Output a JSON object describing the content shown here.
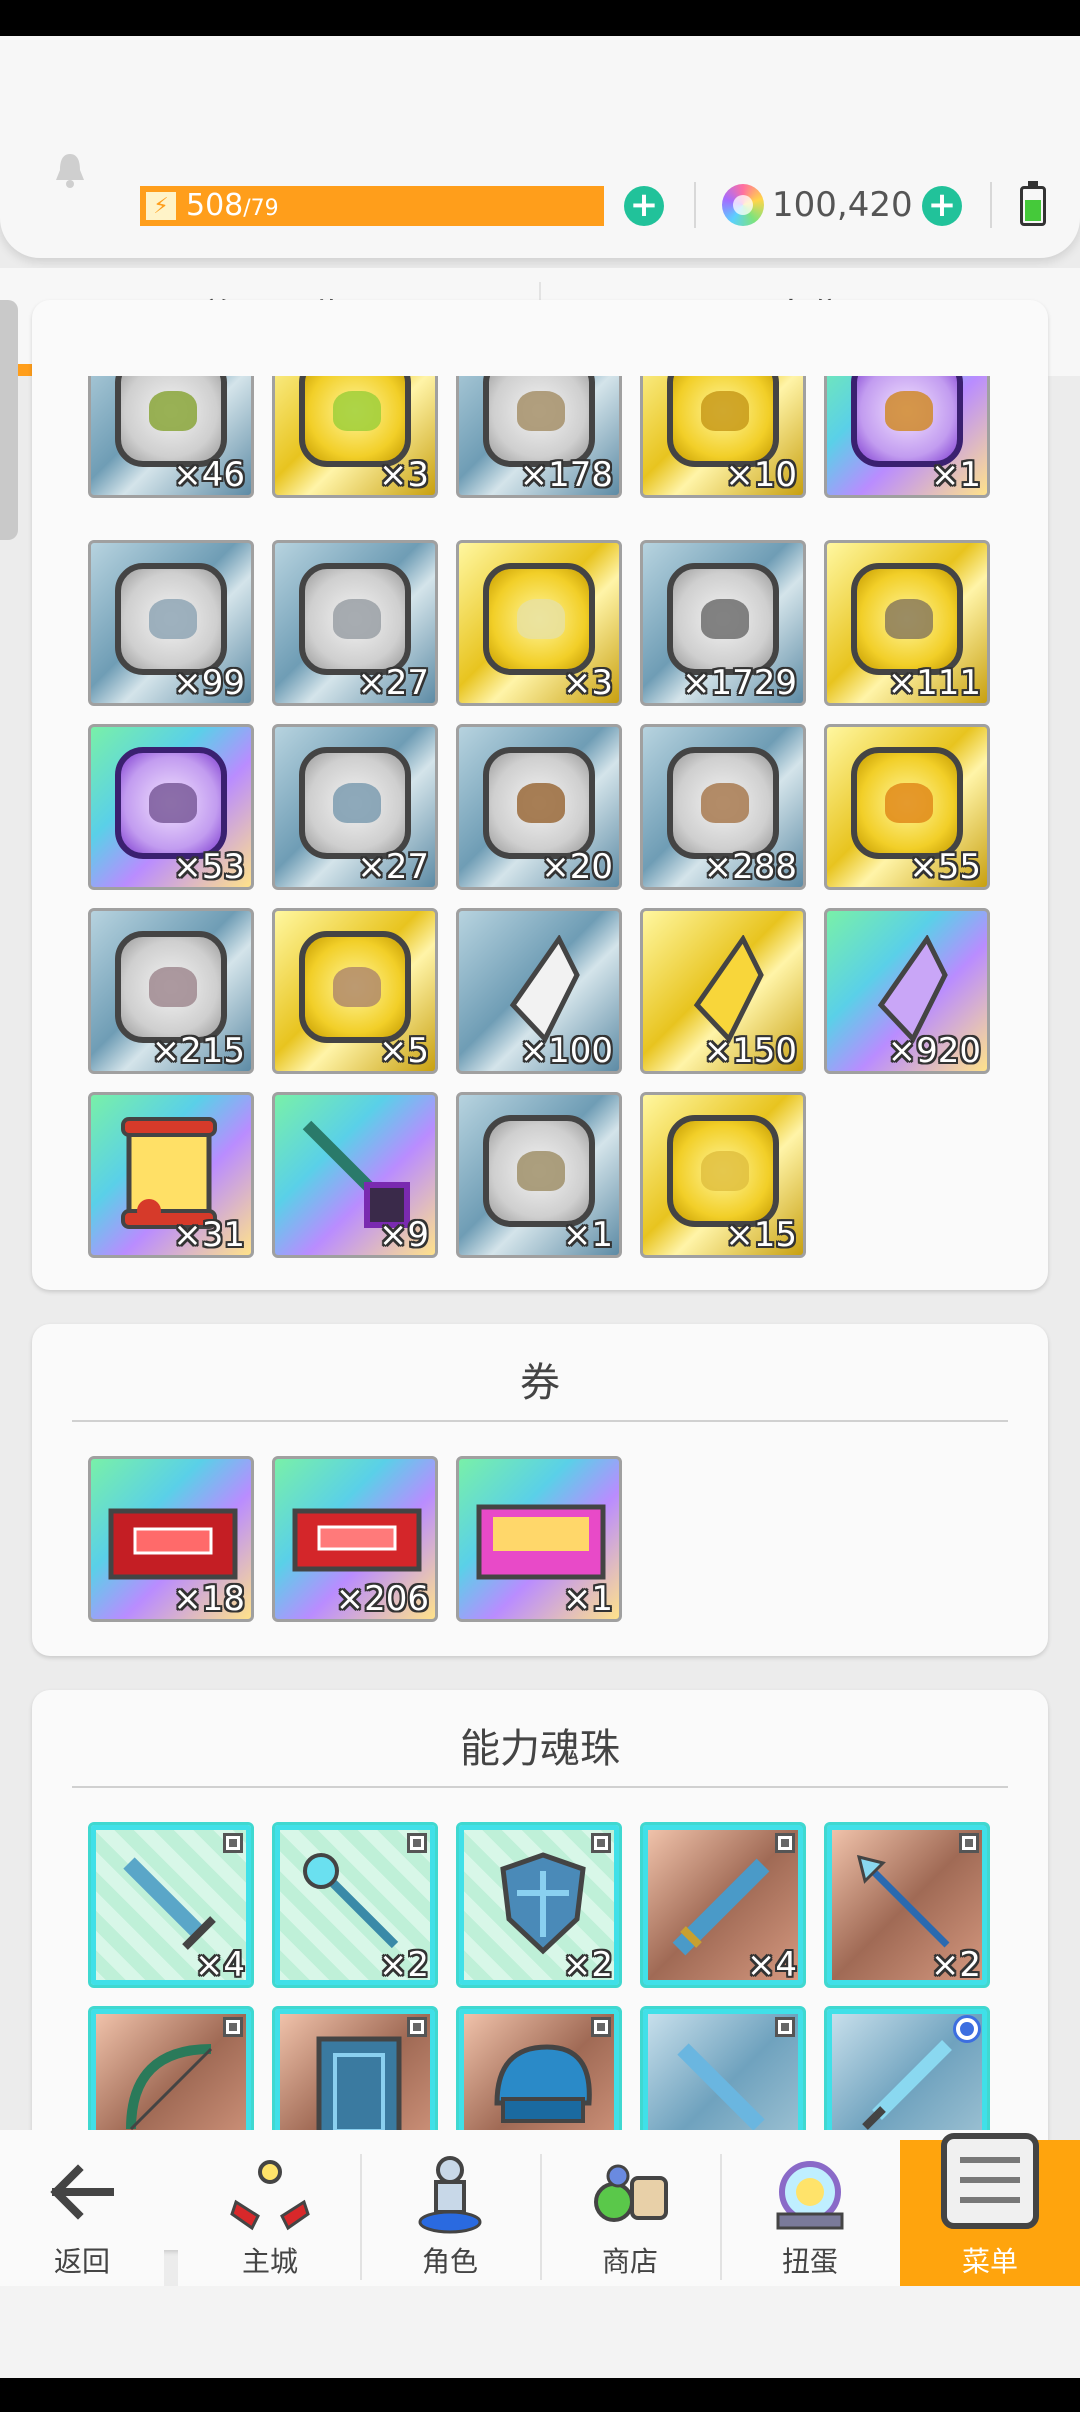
{
  "header": {
    "stamina_current": "508",
    "stamina_max": "/79",
    "gems": "100,420"
  },
  "tabs": [
    {
      "label": "道具一览",
      "active": true
    },
    {
      "label": "出售",
      "active": false
    }
  ],
  "sections": {
    "coins": {
      "rows": [
        [
          {
            "icon": "green-slime-coin-icon",
            "count": "×46"
          },
          {
            "icon": "gold-slime-coin-icon",
            "count": "×3"
          },
          {
            "icon": "silver-beast-coin-icon",
            "count": "×178"
          },
          {
            "icon": "gold-beast-coin-icon",
            "count": "×10"
          },
          {
            "icon": "purple-beast-coin-icon",
            "count": "×1"
          }
        ],
        [
          {
            "icon": "silver-bird-coin-icon",
            "count": "×99"
          },
          {
            "icon": "silver-bat-coin-icon",
            "count": "×27"
          },
          {
            "icon": "gold-bat-coin-icon",
            "count": "×3"
          },
          {
            "icon": "silver-dragon-coin-icon",
            "count": "×1729"
          },
          {
            "icon": "gold-dragon-coin-icon",
            "count": "×111"
          }
        ],
        [
          {
            "icon": "purple-dragon-coin-icon",
            "count": "×53"
          },
          {
            "icon": "silver-knight-coin-icon",
            "count": "×27"
          },
          {
            "icon": "bronze-golem-coin-icon",
            "count": "×20"
          },
          {
            "icon": "bronze-lion-coin-icon",
            "count": "×288"
          },
          {
            "icon": "gold-lion-coin-icon",
            "count": "×55"
          }
        ],
        [
          {
            "icon": "silver-demon-coin-icon",
            "count": "×215"
          },
          {
            "icon": "gold-demon-coin-icon",
            "count": "×5"
          },
          {
            "icon": "white-crystal-icon",
            "count": "×100"
          },
          {
            "icon": "gold-crystal-icon",
            "count": "×150"
          },
          {
            "icon": "purple-crystal-icon",
            "count": "×920"
          }
        ],
        [
          {
            "icon": "scroll-icon",
            "count": "×31"
          },
          {
            "icon": "key-icon",
            "count": "×9"
          },
          {
            "icon": "silver-rune-coin-icon",
            "count": "×1"
          },
          {
            "icon": "gold-rune-coin-icon",
            "count": "×15"
          }
        ]
      ]
    },
    "tickets": {
      "title": "券",
      "items": [
        {
          "icon": "red-ticket-icon",
          "count": "×18"
        },
        {
          "icon": "red-ticket-icon",
          "count": "×206"
        },
        {
          "icon": "rainbow-ticket-icon",
          "count": "×1"
        }
      ]
    },
    "orbs": {
      "title": "能力魂珠",
      "rows": [
        [
          {
            "icon": "sword-icon",
            "count": "×4"
          },
          {
            "icon": "staff-icon",
            "count": "×2"
          },
          {
            "icon": "shield-icon",
            "count": "×2"
          },
          {
            "icon": "greatsword-icon",
            "count": "×4"
          },
          {
            "icon": "spear-icon",
            "count": "×2"
          }
        ],
        [
          {
            "icon": "bow-icon",
            "count": ""
          },
          {
            "icon": "book-icon",
            "count": ""
          },
          {
            "icon": "helmet-icon",
            "count": ""
          },
          {
            "icon": "blade-icon",
            "count": ""
          },
          {
            "icon": "dagger-icon",
            "count": ""
          }
        ]
      ]
    }
  },
  "nav": {
    "back": "返回",
    "items": [
      "主城",
      "角色",
      "商店",
      "扭蛋",
      "菜单"
    ]
  },
  "colors": {
    "accent": "#ffa40d",
    "plus": "#21c29a"
  }
}
